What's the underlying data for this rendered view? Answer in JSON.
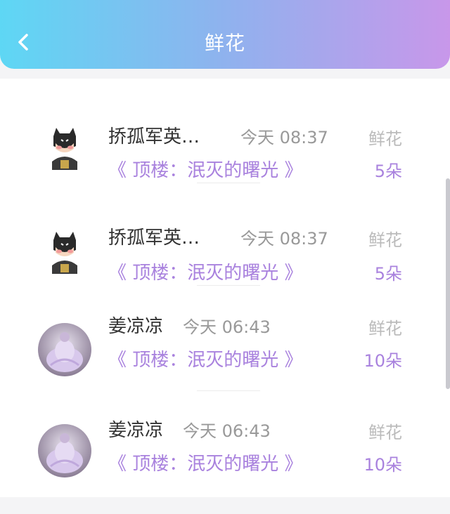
{
  "header": {
    "title": "鲜花",
    "back_icon": "chevron-left-icon",
    "gradient": [
      "#5ed7f4",
      "#c897ea"
    ]
  },
  "records": [
    {
      "avatar": "batman-cartoon-avatar",
      "name": "挢孤军英…",
      "time": "今天 08:37",
      "book": "《 顶楼：泯灭的曙光 》",
      "gift_type": "鲜花",
      "count": "5朵"
    },
    {
      "avatar": "batman-cartoon-avatar",
      "name": "挢孤军英…",
      "time": "今天 08:37",
      "book": "《 顶楼：泯灭的曙光 》",
      "gift_type": "鲜花",
      "count": "5朵"
    },
    {
      "avatar": "lavender-dress-photo-avatar",
      "name": "姜凉凉",
      "time": "今天 06:43",
      "book": "《 顶楼：泯灭的曙光 》",
      "gift_type": "鲜花",
      "count": "10朵"
    },
    {
      "avatar": "lavender-dress-photo-avatar",
      "name": "姜凉凉",
      "time": "今天 06:43",
      "book": "《 顶楼：泯灭的曙光 》",
      "gift_type": "鲜花",
      "count": "10朵"
    }
  ],
  "colors": {
    "accent": "#a982de",
    "muted": "#999999"
  }
}
